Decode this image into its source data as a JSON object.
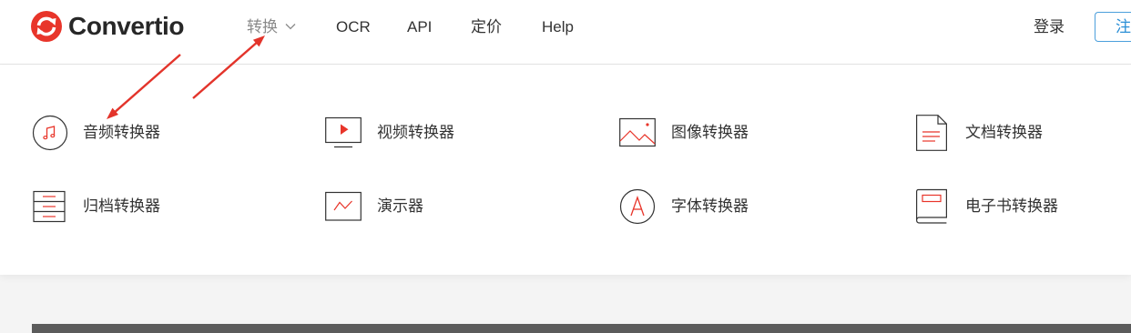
{
  "header": {
    "logo_text": "Convertio",
    "logo_icon": "convertio-logo-icon",
    "nav": [
      {
        "label": "转换",
        "active": true,
        "icon": "chevron-down-icon"
      },
      {
        "label": "OCR"
      },
      {
        "label": "API"
      },
      {
        "label": "定价"
      },
      {
        "label": "Help"
      }
    ],
    "login_label": "登录",
    "register_label": "注"
  },
  "dropdown": {
    "items": [
      {
        "label": "音频转换器",
        "icon": "music-note-icon"
      },
      {
        "label": "视频转换器",
        "icon": "video-play-icon"
      },
      {
        "label": "图像转换器",
        "icon": "image-icon"
      },
      {
        "label": "文档转换器",
        "icon": "document-icon"
      },
      {
        "label": "归档转换器",
        "icon": "archive-icon"
      },
      {
        "label": "演示器",
        "icon": "presentation-icon"
      },
      {
        "label": "字体转换器",
        "icon": "font-icon"
      },
      {
        "label": "电子书转换器",
        "icon": "ebook-icon"
      }
    ]
  },
  "colors": {
    "brand_red": "#e8352a",
    "text": "#333333",
    "nav_active": "#8a8a8a",
    "register_blue": "#2b8fd6",
    "annotation_arrow": "#e3342b",
    "footer_bar": "#5b5b5b"
  }
}
